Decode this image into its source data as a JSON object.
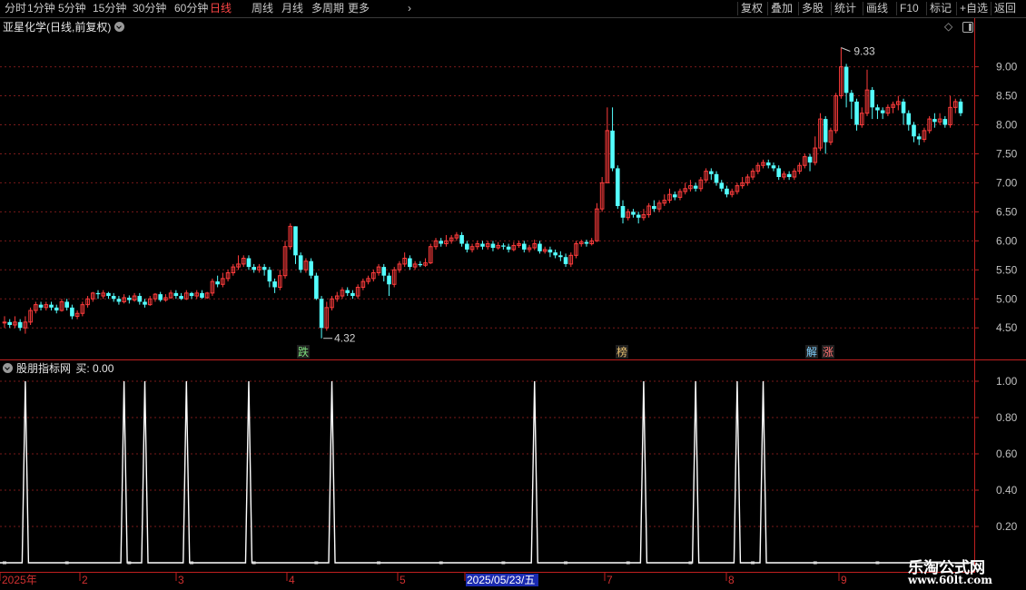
{
  "toolbar": {
    "periods": [
      "分时",
      "1分钟",
      "5分钟",
      "15分钟",
      "30分钟",
      "60分钟",
      "日线",
      "周线",
      "月线",
      "多周期",
      "更多"
    ],
    "active_period": "日线",
    "more_chevron_icon": "chevron-right-icon",
    "right_buttons": [
      "复权",
      "叠加",
      "多股",
      "统计",
      "画线",
      "F10",
      "标记",
      "+自选",
      "返回"
    ]
  },
  "main_chart": {
    "title": "亚星化学(日线,前复权)",
    "title_icon": "chevron-down-circle-icon",
    "right_icons": [
      "diamond-icon",
      "panel-toggle-icon"
    ],
    "y_ticks": [
      "9.00",
      "8.50",
      "8.00",
      "7.50",
      "7.00",
      "6.50",
      "6.00",
      "5.50",
      "5.00",
      "4.50"
    ],
    "high_label": "9.33",
    "low_label": "4.32",
    "markers": [
      {
        "text": "跌",
        "color": "#7fe07f"
      },
      {
        "text": "榜",
        "color": "#e8c070"
      },
      {
        "text": "解",
        "color": "#7fd0ff"
      },
      {
        "text": "涨",
        "color": "#ff7070"
      }
    ]
  },
  "indicator": {
    "title": "股朋指标网",
    "value_label": "买: 0.00",
    "y_ticks": [
      "1.00",
      "0.80",
      "0.60",
      "0.40",
      "0.20"
    ]
  },
  "xaxis": {
    "labels": [
      "2025年",
      "2",
      "3",
      "4",
      "5",
      "2025/05/23/五",
      "7",
      "8",
      "9"
    ],
    "highlight": "2025/05/23/五"
  },
  "watermark": {
    "title": "乐淘公式网",
    "url": "www.60lt.com"
  },
  "colors": {
    "up": "#ff3c3c",
    "down": "#54ffff",
    "grid": "#7a1a1a",
    "axis": "#c02020",
    "signal": "#ffffff",
    "active": "#ff4646"
  },
  "chart_data": {
    "type": "candlestick",
    "title": "亚星化学(日线,前复权)",
    "ylim": [
      4.3,
      9.4
    ],
    "candles": [
      [
        4.6,
        4.6,
        4.7,
        4.5
      ],
      [
        4.6,
        4.55,
        4.65,
        4.5
      ],
      [
        4.55,
        4.6,
        4.7,
        4.5
      ],
      [
        4.6,
        4.5,
        4.65,
        4.45
      ],
      [
        4.5,
        4.6,
        4.7,
        4.4
      ],
      [
        4.6,
        4.8,
        4.85,
        4.55
      ],
      [
        4.8,
        4.9,
        4.95,
        4.75
      ],
      [
        4.9,
        4.85,
        4.95,
        4.8
      ],
      [
        4.85,
        4.9,
        4.95,
        4.8
      ],
      [
        4.9,
        4.85,
        4.95,
        4.8
      ],
      [
        4.85,
        4.8,
        4.9,
        4.75
      ],
      [
        4.8,
        4.95,
        5.0,
        4.78
      ],
      [
        4.95,
        4.85,
        5.0,
        4.8
      ],
      [
        4.85,
        4.7,
        4.9,
        4.65
      ],
      [
        4.7,
        4.75,
        4.8,
        4.65
      ],
      [
        4.75,
        4.9,
        4.95,
        4.7
      ],
      [
        4.9,
        5.0,
        5.05,
        4.85
      ],
      [
        5.0,
        5.1,
        5.12,
        4.95
      ],
      [
        5.1,
        5.08,
        5.15,
        5.0
      ],
      [
        5.05,
        5.1,
        5.15,
        5.0
      ],
      [
        5.1,
        5.05,
        5.12,
        5.0
      ],
      [
        5.05,
        5.0,
        5.1,
        4.95
      ],
      [
        5.0,
        4.95,
        5.05,
        4.9
      ],
      [
        4.95,
        5.02,
        5.08,
        4.92
      ],
      [
        5.02,
        4.98,
        5.06,
        4.92
      ],
      [
        4.98,
        5.05,
        5.1,
        4.95
      ],
      [
        5.05,
        4.95,
        5.1,
        4.9
      ],
      [
        4.95,
        4.9,
        5.0,
        4.85
      ],
      [
        4.9,
        5.0,
        5.05,
        4.88
      ],
      [
        5.0,
        5.08,
        5.1,
        4.95
      ],
      [
        5.08,
        4.98,
        5.12,
        4.95
      ],
      [
        4.98,
        5.02,
        5.08,
        4.95
      ],
      [
        5.02,
        5.1,
        5.15,
        5.0
      ],
      [
        5.1,
        5.05,
        5.15,
        5.0
      ],
      [
        5.05,
        5.0,
        5.1,
        4.98
      ],
      [
        5.0,
        5.1,
        5.15,
        4.98
      ],
      [
        5.1,
        5.05,
        5.12,
        5.0
      ],
      [
        5.05,
        5.1,
        5.15,
        5.0
      ],
      [
        5.1,
        5.02,
        5.15,
        5.0
      ],
      [
        5.02,
        5.1,
        5.12,
        5.0
      ],
      [
        5.1,
        5.3,
        5.35,
        5.05
      ],
      [
        5.3,
        5.25,
        5.4,
        5.2
      ],
      [
        5.25,
        5.35,
        5.45,
        5.2
      ],
      [
        5.35,
        5.45,
        5.5,
        5.3
      ],
      [
        5.45,
        5.55,
        5.6,
        5.4
      ],
      [
        5.55,
        5.6,
        5.75,
        5.5
      ],
      [
        5.6,
        5.7,
        5.75,
        5.55
      ],
      [
        5.7,
        5.55,
        5.75,
        5.5
      ],
      [
        5.55,
        5.5,
        5.6,
        5.45
      ],
      [
        5.5,
        5.55,
        5.6,
        5.45
      ],
      [
        5.55,
        5.5,
        5.6,
        5.4
      ],
      [
        5.5,
        5.3,
        5.55,
        5.2
      ],
      [
        5.3,
        5.2,
        5.35,
        5.1
      ],
      [
        5.2,
        5.4,
        5.5,
        5.15
      ],
      [
        5.4,
        5.9,
        6.0,
        5.35
      ],
      [
        5.9,
        6.25,
        6.3,
        5.85
      ],
      [
        6.25,
        5.75,
        6.25,
        5.6
      ],
      [
        5.75,
        5.5,
        5.8,
        5.45
      ],
      [
        5.5,
        5.65,
        5.7,
        5.45
      ],
      [
        5.65,
        5.4,
        5.7,
        5.35
      ],
      [
        5.4,
        5.0,
        5.45,
        4.98
      ],
      [
        5.0,
        4.5,
        5.05,
        4.32
      ],
      [
        4.5,
        4.85,
        4.95,
        4.45
      ],
      [
        4.85,
        5.0,
        5.05,
        4.8
      ],
      [
        5.0,
        5.05,
        5.12,
        4.95
      ],
      [
        5.05,
        5.15,
        5.2,
        5.0
      ],
      [
        5.15,
        5.1,
        5.2,
        5.05
      ],
      [
        5.1,
        5.05,
        5.15,
        5.0
      ],
      [
        5.05,
        5.2,
        5.25,
        5.0
      ],
      [
        5.2,
        5.3,
        5.35,
        5.15
      ],
      [
        5.3,
        5.35,
        5.4,
        5.25
      ],
      [
        5.35,
        5.45,
        5.5,
        5.3
      ],
      [
        5.45,
        5.55,
        5.6,
        5.4
      ],
      [
        5.55,
        5.4,
        5.6,
        5.3
      ],
      [
        5.4,
        5.25,
        5.45,
        5.05
      ],
      [
        5.25,
        5.5,
        5.55,
        5.2
      ],
      [
        5.5,
        5.6,
        5.65,
        5.45
      ],
      [
        5.6,
        5.7,
        5.8,
        5.55
      ],
      [
        5.7,
        5.55,
        5.75,
        5.5
      ],
      [
        5.55,
        5.6,
        5.65,
        5.5
      ],
      [
        5.6,
        5.58,
        5.65,
        5.55
      ],
      [
        5.58,
        5.62,
        5.7,
        5.55
      ],
      [
        5.62,
        5.9,
        5.95,
        5.6
      ],
      [
        5.9,
        6.0,
        6.05,
        5.85
      ],
      [
        6.0,
        5.95,
        6.05,
        5.9
      ],
      [
        5.95,
        6.0,
        6.1,
        5.9
      ],
      [
        6.0,
        6.05,
        6.1,
        5.95
      ],
      [
        6.05,
        6.1,
        6.15,
        6.0
      ],
      [
        6.1,
        5.95,
        6.15,
        5.9
      ],
      [
        5.95,
        5.85,
        6.0,
        5.8
      ],
      [
        5.85,
        5.9,
        5.95,
        5.8
      ],
      [
        5.9,
        5.95,
        6.0,
        5.85
      ],
      [
        5.95,
        5.9,
        6.0,
        5.85
      ],
      [
        5.9,
        5.95,
        6.0,
        5.85
      ],
      [
        5.95,
        5.88,
        6.0,
        5.82
      ],
      [
        5.88,
        5.92,
        5.98,
        5.85
      ],
      [
        5.92,
        5.9,
        5.96,
        5.85
      ],
      [
        5.9,
        5.85,
        5.95,
        5.8
      ],
      [
        5.85,
        5.92,
        5.98,
        5.82
      ],
      [
        5.92,
        5.95,
        6.0,
        5.88
      ],
      [
        5.95,
        5.85,
        6.0,
        5.8
      ],
      [
        5.85,
        5.88,
        5.93,
        5.8
      ],
      [
        5.88,
        5.95,
        6.02,
        5.84
      ],
      [
        5.95,
        5.82,
        6.0,
        5.78
      ],
      [
        5.82,
        5.85,
        5.9,
        5.78
      ],
      [
        5.85,
        5.8,
        5.9,
        5.72
      ],
      [
        5.8,
        5.75,
        5.85,
        5.7
      ],
      [
        5.75,
        5.72,
        5.82,
        5.65
      ],
      [
        5.72,
        5.6,
        5.78,
        5.55
      ],
      [
        5.6,
        5.75,
        5.8,
        5.55
      ],
      [
        5.75,
        5.95,
        6.0,
        5.7
      ],
      [
        5.95,
        5.98,
        6.02,
        5.9
      ],
      [
        5.98,
        5.95,
        6.02,
        5.9
      ],
      [
        5.95,
        6.0,
        6.05,
        5.92
      ],
      [
        6.0,
        6.55,
        6.65,
        5.98
      ],
      [
        6.55,
        7.0,
        7.1,
        6.5
      ],
      [
        7.0,
        7.9,
        8.3,
        7.0
      ],
      [
        7.9,
        7.25,
        8.3,
        7.2
      ],
      [
        7.25,
        6.6,
        7.3,
        6.55
      ],
      [
        6.6,
        6.4,
        6.7,
        6.3
      ],
      [
        6.4,
        6.5,
        6.55,
        6.35
      ],
      [
        6.5,
        6.45,
        6.55,
        6.4
      ],
      [
        6.45,
        6.4,
        6.5,
        6.3
      ],
      [
        6.4,
        6.45,
        6.55,
        6.35
      ],
      [
        6.45,
        6.6,
        6.65,
        6.4
      ],
      [
        6.6,
        6.55,
        6.7,
        6.5
      ],
      [
        6.55,
        6.65,
        6.7,
        6.5
      ],
      [
        6.65,
        6.7,
        6.8,
        6.6
      ],
      [
        6.7,
        6.8,
        6.9,
        6.65
      ],
      [
        6.8,
        6.75,
        6.85,
        6.7
      ],
      [
        6.75,
        6.85,
        6.9,
        6.7
      ],
      [
        6.85,
        6.9,
        7.0,
        6.8
      ],
      [
        6.9,
        6.95,
        7.05,
        6.85
      ],
      [
        6.95,
        6.9,
        7.0,
        6.85
      ],
      [
        6.9,
        7.05,
        7.1,
        6.85
      ],
      [
        7.05,
        7.2,
        7.25,
        7.0
      ],
      [
        7.2,
        7.15,
        7.25,
        7.05
      ],
      [
        7.15,
        7.0,
        7.2,
        6.95
      ],
      [
        7.0,
        6.9,
        7.05,
        6.85
      ],
      [
        6.9,
        6.8,
        6.95,
        6.75
      ],
      [
        6.8,
        6.85,
        6.9,
        6.75
      ],
      [
        6.85,
        6.95,
        7.0,
        6.8
      ],
      [
        6.95,
        7.0,
        7.1,
        6.9
      ],
      [
        7.0,
        7.1,
        7.15,
        6.95
      ],
      [
        7.1,
        7.2,
        7.25,
        7.05
      ],
      [
        7.2,
        7.3,
        7.35,
        7.15
      ],
      [
        7.3,
        7.35,
        7.4,
        7.25
      ],
      [
        7.35,
        7.3,
        7.4,
        7.25
      ],
      [
        7.3,
        7.25,
        7.35,
        7.2
      ],
      [
        7.25,
        7.1,
        7.3,
        7.05
      ],
      [
        7.1,
        7.15,
        7.2,
        7.05
      ],
      [
        7.15,
        7.1,
        7.2,
        7.05
      ],
      [
        7.1,
        7.2,
        7.25,
        7.05
      ],
      [
        7.2,
        7.3,
        7.35,
        7.15
      ],
      [
        7.3,
        7.45,
        7.5,
        7.25
      ],
      [
        7.45,
        7.35,
        7.5,
        7.2
      ],
      [
        7.35,
        7.6,
        7.8,
        7.3
      ],
      [
        7.6,
        8.1,
        8.2,
        7.55
      ],
      [
        8.1,
        7.7,
        8.15,
        7.5
      ],
      [
        7.7,
        7.9,
        7.95,
        7.65
      ],
      [
        7.9,
        8.5,
        8.55,
        7.85
      ],
      [
        8.5,
        9.0,
        9.33,
        8.45
      ],
      [
        9.0,
        8.55,
        9.05,
        8.3
      ],
      [
        8.55,
        8.4,
        8.6,
        8.1
      ],
      [
        8.4,
        8.0,
        8.45,
        7.9
      ],
      [
        8.0,
        8.2,
        8.3,
        7.95
      ],
      [
        8.2,
        8.6,
        8.95,
        8.15
      ],
      [
        8.6,
        8.3,
        8.65,
        8.1
      ],
      [
        8.3,
        8.25,
        8.35,
        8.1
      ],
      [
        8.25,
        8.2,
        8.3,
        8.1
      ],
      [
        8.2,
        8.3,
        8.35,
        8.15
      ],
      [
        8.3,
        8.35,
        8.4,
        8.2
      ],
      [
        8.35,
        8.4,
        8.5,
        8.25
      ],
      [
        8.4,
        8.2,
        8.45,
        8.0
      ],
      [
        8.2,
        8.0,
        8.25,
        7.9
      ],
      [
        8.0,
        7.8,
        8.05,
        7.7
      ],
      [
        7.8,
        7.75,
        7.85,
        7.65
      ],
      [
        7.75,
        7.9,
        7.95,
        7.7
      ],
      [
        7.9,
        8.1,
        8.15,
        7.85
      ],
      [
        8.1,
        8.05,
        8.2,
        7.95
      ],
      [
        8.05,
        8.1,
        8.2,
        8.0
      ],
      [
        8.1,
        8.0,
        8.15,
        7.95
      ],
      [
        8.0,
        8.3,
        8.5,
        7.95
      ],
      [
        8.3,
        8.4,
        8.45,
        8.2
      ],
      [
        8.4,
        8.2,
        8.45,
        8.15
      ]
    ],
    "high": 9.33,
    "low": 4.32,
    "indicator_series": {
      "name": "买",
      "ylim": [
        0,
        1.05
      ],
      "spike_indices": [
        4,
        23,
        27,
        35,
        47,
        63,
        102,
        123,
        133,
        141,
        146
      ]
    }
  }
}
